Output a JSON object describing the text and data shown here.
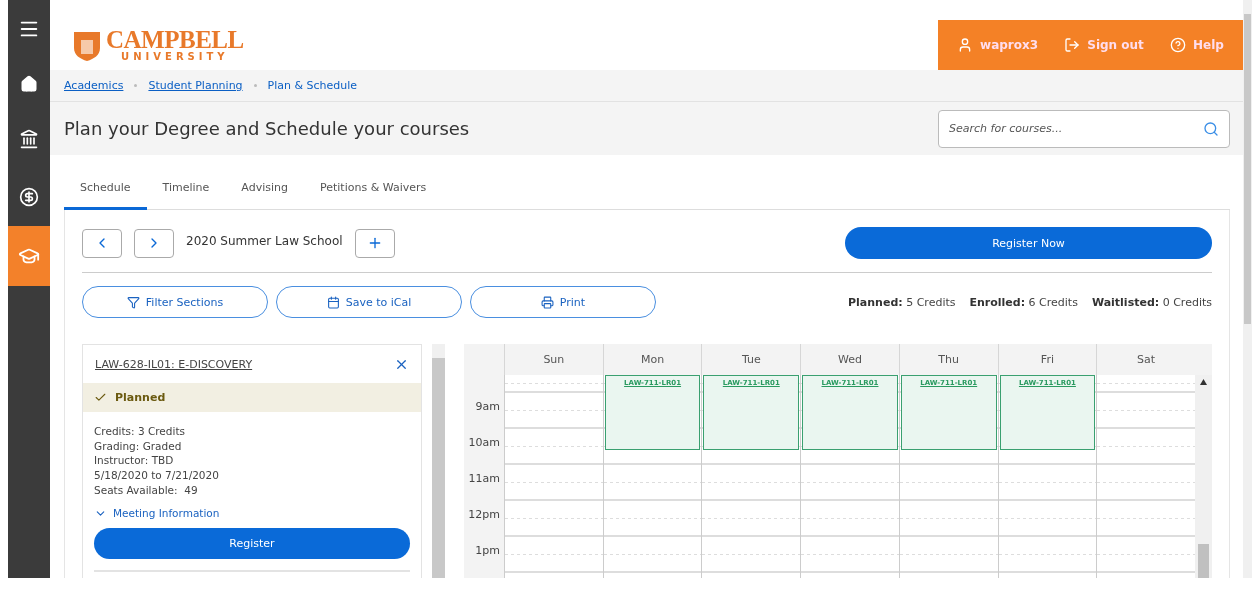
{
  "sidebar": {
    "items": [
      {
        "kind": "menu",
        "selected": false
      },
      {
        "kind": "home",
        "selected": false
      },
      {
        "kind": "bank",
        "selected": false
      },
      {
        "kind": "finance",
        "selected": false
      },
      {
        "kind": "academics",
        "selected": true
      }
    ]
  },
  "header": {
    "logo": {
      "name": "CAMPBELL",
      "subtitle": "UNIVERSITY"
    },
    "user_bar": [
      {
        "kind": "user",
        "label": "waprox3"
      },
      {
        "kind": "signout",
        "label": "Sign out"
      },
      {
        "kind": "help",
        "label": "Help"
      }
    ]
  },
  "breadcrumbs": [
    {
      "label": "Academics",
      "link": true
    },
    {
      "label": "Student Planning",
      "link": true
    },
    {
      "label": "Plan & Schedule",
      "link": false
    }
  ],
  "page_title": "Plan your Degree and Schedule your courses",
  "search": {
    "placeholder": "Search for courses..."
  },
  "tabs": [
    {
      "label": "Schedule",
      "selected": true
    },
    {
      "label": "Timeline",
      "selected": false
    },
    {
      "label": "Advising",
      "selected": false
    },
    {
      "label": "Petitions & Waivers",
      "selected": false
    }
  ],
  "term": {
    "name": "2020 Summer Law School",
    "register_button": "Register Now"
  },
  "actions": [
    {
      "kind": "filter",
      "label": "Filter Sections"
    },
    {
      "kind": "calendar",
      "label": "Save to iCal"
    },
    {
      "kind": "print",
      "label": "Print"
    }
  ],
  "credits": [
    {
      "label": "Planned:",
      "value": "5 Credits"
    },
    {
      "label": "Enrolled:",
      "value": "6 Credits"
    },
    {
      "label": "Waitlisted:",
      "value": "0 Credits"
    }
  ],
  "course_card": {
    "title": "LAW-628-IL01: E-DISCOVERY",
    "status": "Planned",
    "details": [
      "Credits: 3 Credits",
      "Grading: Graded",
      "Instructor: TBD",
      "5/18/2020 to 7/21/2020",
      "Seats Available:  49"
    ],
    "meeting_info": "Meeting Information",
    "expanded": false,
    "button": "Register"
  },
  "calendar": {
    "days": [
      {
        "label": "Sun"
      },
      {
        "label": "Mon",
        "events": [
          "LAW-711-LR01"
        ]
      },
      {
        "label": "Tue",
        "events": [
          "LAW-711-LR01"
        ]
      },
      {
        "label": "Wed",
        "events": [
          "LAW-711-LR01"
        ]
      },
      {
        "label": "Thu",
        "events": [
          "LAW-711-LR01"
        ]
      },
      {
        "label": "Fri",
        "events": [
          "LAW-711-LR01"
        ]
      },
      {
        "label": "Sat"
      }
    ],
    "times": [
      "9am",
      "10am",
      "11am",
      "12pm",
      "1pm"
    ]
  }
}
